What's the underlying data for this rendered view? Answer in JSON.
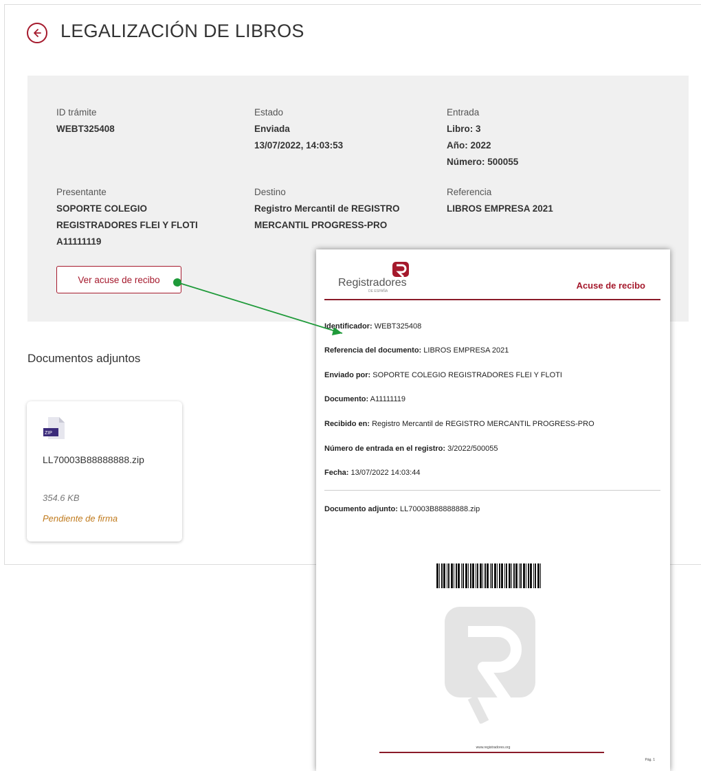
{
  "header": {
    "title": "LEGALIZACIÓN DE LIBROS"
  },
  "info": {
    "id_label": "ID trámite",
    "id_value": "WEBT325408",
    "estado_label": "Estado",
    "estado_value": "Enviada",
    "estado_date": "13/07/2022, 14:03:53",
    "entrada_label": "Entrada",
    "entrada_libro": "Libro: 3",
    "entrada_anio": "Año: 2022",
    "entrada_numero": "Número: 500055",
    "presentante_label": "Presentante",
    "presentante_line1": "SOPORTE COLEGIO",
    "presentante_line2": "REGISTRADORES FLEI Y FLOTI",
    "presentante_line3": "A11111119",
    "destino_label": "Destino",
    "destino_line1": "Registro Mercantil de REGISTRO",
    "destino_line2": "MERCANTIL PROGRESS-PRO",
    "referencia_label": "Referencia",
    "referencia_value": "LIBROS EMPRESA 2021",
    "acuse_button": "Ver acuse de recibo"
  },
  "documents": {
    "title": "Documentos adjuntos",
    "items": [
      {
        "icon_badge": "ZIP",
        "name": "LL70003B88888888.zip",
        "size": "354.6 KB",
        "status": "Pendiente de firma"
      }
    ]
  },
  "receipt": {
    "logo_text": "Registradores",
    "logo_sub": "DE ESPAÑA",
    "heading": "Acuse de recibo",
    "rows": [
      {
        "label": "Identificador:",
        "value": "WEBT325408"
      },
      {
        "label": "Referencia del documento:",
        "value": "LIBROS EMPRESA 2021"
      },
      {
        "label": "Enviado por:",
        "value": "SOPORTE COLEGIO REGISTRADORES FLEI Y FLOTI"
      },
      {
        "label": "Documento:",
        "value": "A11111119"
      },
      {
        "label": "Recibido en:",
        "value": "Registro Mercantil de REGISTRO MERCANTIL PROGRESS-PRO"
      },
      {
        "label": "Número de entrada en el registro:",
        "value": "3/2022/500055"
      },
      {
        "label": "Fecha:",
        "value": "13/07/2022 14:03:44"
      }
    ],
    "attachment": {
      "label": "Documento adjunto:",
      "value": "LL70003B88888888.zip"
    },
    "footer_url": "www.registradores.org",
    "page_label": "Pág. 1"
  },
  "colors": {
    "brand": "#a5192c",
    "panel_bg": "#f0f0f0",
    "status_pending": "#c07a1c",
    "annotation_arrow": "#1f9a3a"
  }
}
